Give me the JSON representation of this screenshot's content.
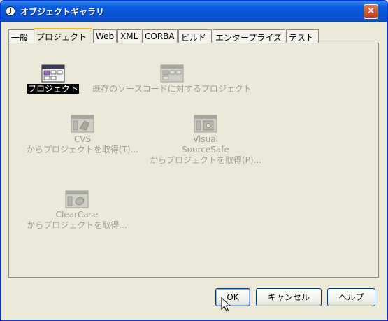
{
  "window": {
    "title": "オブジェクトギャラリ",
    "close_glyph": "✕",
    "title_icon_glyph": "J"
  },
  "tabs": [
    {
      "label": "一般",
      "active": false
    },
    {
      "label": "プロジェクト",
      "active": true
    },
    {
      "label": "Web",
      "active": false
    },
    {
      "label": "XML",
      "active": false
    },
    {
      "label": "CORBA",
      "active": false
    },
    {
      "label": "ビルド",
      "active": false
    },
    {
      "label": "エンタープライズ",
      "active": false
    },
    {
      "label": "テスト",
      "active": false
    }
  ],
  "items": [
    {
      "label": "プロジェクト",
      "icon": "project-icon",
      "selected": true,
      "enabled": true
    },
    {
      "label": "既存のソースコードに対するプロジェクト",
      "icon": "existing-source-project-icon",
      "enabled": false
    },
    {
      "label_lines": [
        "CVS",
        "からプロジェクトを取得(T)..."
      ],
      "icon": "cvs-icon",
      "enabled": false
    },
    {
      "label_lines": [
        "Visual",
        "SourceSafe",
        "からプロジェクトを取得(P)..."
      ],
      "icon": "sourcesafe-icon",
      "enabled": false
    },
    {
      "label_lines": [
        "ClearCase",
        "からプロジェクトを取得..."
      ],
      "icon": "clearcase-icon",
      "enabled": false
    }
  ],
  "buttons": {
    "ok": "OK",
    "cancel": "キャンセル",
    "help": "ヘルプ"
  },
  "colors": {
    "titlebar": "#0a5ddc",
    "face": "#ece9d8",
    "disabled_text": "#a0a096",
    "tab_highlight": "#f2b633"
  }
}
